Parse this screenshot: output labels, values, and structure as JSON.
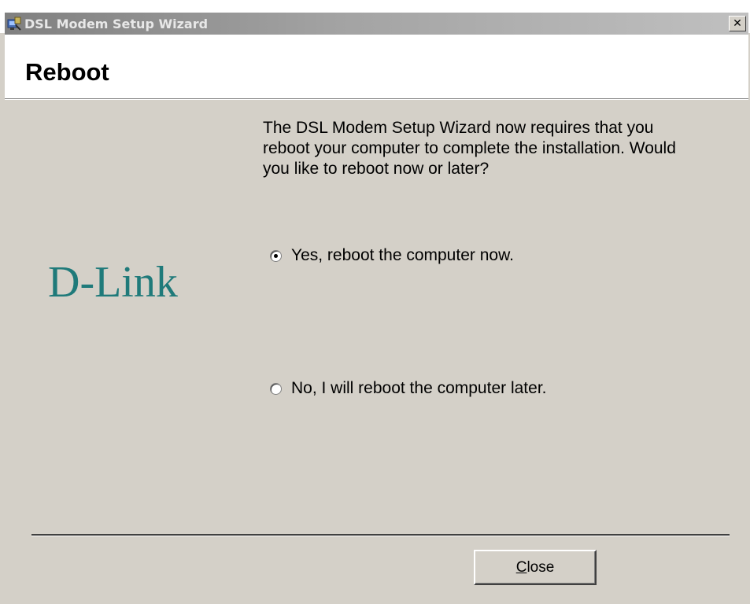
{
  "window": {
    "title": "DSL Modem Setup Wizard",
    "close_glyph": "✕"
  },
  "header": {
    "title": "Reboot"
  },
  "brand": {
    "logo_text": "D-Link",
    "logo_color": "#1f7a7a"
  },
  "body": {
    "instructions": "The DSL Modem Setup Wizard now requires that you reboot your computer to complete the installation.  Would you like to reboot now or later?"
  },
  "options": [
    {
      "label": "Yes, reboot the computer now.",
      "selected": true
    },
    {
      "label": "No, I will reboot the computer later.",
      "selected": false
    }
  ],
  "footer": {
    "close_button": {
      "accel": "C",
      "rest": "lose"
    }
  },
  "icons": {
    "app": "setup-wizard-icon",
    "close": "close-icon"
  }
}
